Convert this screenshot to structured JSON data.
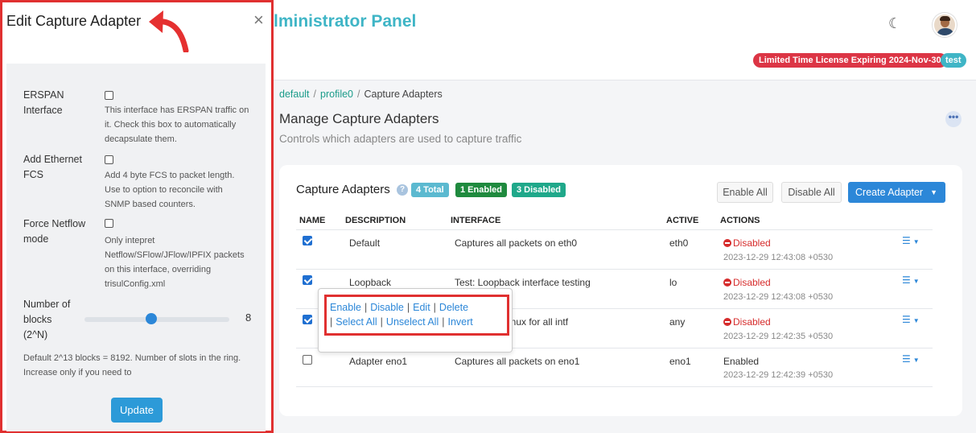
{
  "header": {
    "title": "lministrator Panel",
    "license_badge": "Limited Time License Expiring 2024-Nov-30",
    "user_badge": "test"
  },
  "breadcrumb": [
    "default",
    "profile0",
    "Capture Adapters"
  ],
  "page": {
    "title": "Manage Capture Adapters",
    "subtitle": "Controls which adapters are used to capture traffic",
    "more_label": "•••"
  },
  "card": {
    "title": "Capture Adapters",
    "help_icon": "?",
    "badges": {
      "total": "4 Total",
      "enabled": "1 Enabled",
      "disabled": "3 Disabled"
    },
    "buttons": {
      "enable_all": "Enable All",
      "disable_all": "Disable All",
      "create": "Create Adapter"
    },
    "columns": [
      "NAME",
      "DESCRIPTION",
      "INTERFACE",
      "ACTIVE",
      "ACTIONS"
    ],
    "rows": [
      {
        "checked": true,
        "description": "Default",
        "interface": "Captures all packets on eth0",
        "active": "eth0",
        "status": "Disabled",
        "status_type": "disabled",
        "timestamp": "2023-12-29 12:43:08 +0530"
      },
      {
        "checked": true,
        "description": "Loopback",
        "interface": "Test: Loopback interface testing",
        "active": "lo",
        "status": "Disabled",
        "status_type": "disabled",
        "timestamp": "2023-12-29 12:43:08 +0530"
      },
      {
        "checked": true,
        "description": "",
        "interface": "inux for all intf",
        "active": "any",
        "status": "Disabled",
        "status_type": "disabled",
        "timestamp": "2023-12-29 12:42:35 +0530"
      },
      {
        "checked": false,
        "description": "Adapter eno1",
        "interface": "Captures all packets on eno1",
        "active": "eno1",
        "status": "Enabled",
        "status_type": "enabled",
        "timestamp": "2023-12-29 12:42:39 +0530"
      }
    ]
  },
  "context_menu": {
    "line1": [
      "Enable",
      "Disable",
      "Edit",
      "Delete"
    ],
    "line2": [
      "Select All",
      "Unselect All",
      "Invert"
    ],
    "separator": "|"
  },
  "editor": {
    "title": "Edit Capture Adapter",
    "close": "×",
    "fields": {
      "erspan": {
        "label": "ERSPAN Interface",
        "help": "This interface has ERSPAN traffic on it. Check this box to automatically decapsulate them."
      },
      "fcs": {
        "label": "Add Ethernet FCS",
        "help": "Add 4 byte FCS to packet length. Use to option to reconcile with SNMP based counters."
      },
      "netflow": {
        "label": "Force Netflow mode",
        "help": "Only intepret Netflow/SFlow/JFlow/IPFIX packets on this interface, overriding trisulConfig.xml"
      },
      "blocks": {
        "label": "Number of blocks (2^N)",
        "value": "8",
        "slider_fraction": 0.46
      }
    },
    "footer_help": "Default 2^13 blocks = 8192. Number of slots in the ring. Increase only if you need to",
    "update": "Update"
  },
  "colors": {
    "accent": "#2c87d8",
    "brand": "#3fb5c6",
    "danger": "#dc3545",
    "highlight": "#e03030"
  },
  "icons": {
    "theme": "moon-icon",
    "help": "help-icon",
    "row_menu": "list-icon",
    "close": "close-icon",
    "arrow": "annotation-arrow-icon"
  }
}
